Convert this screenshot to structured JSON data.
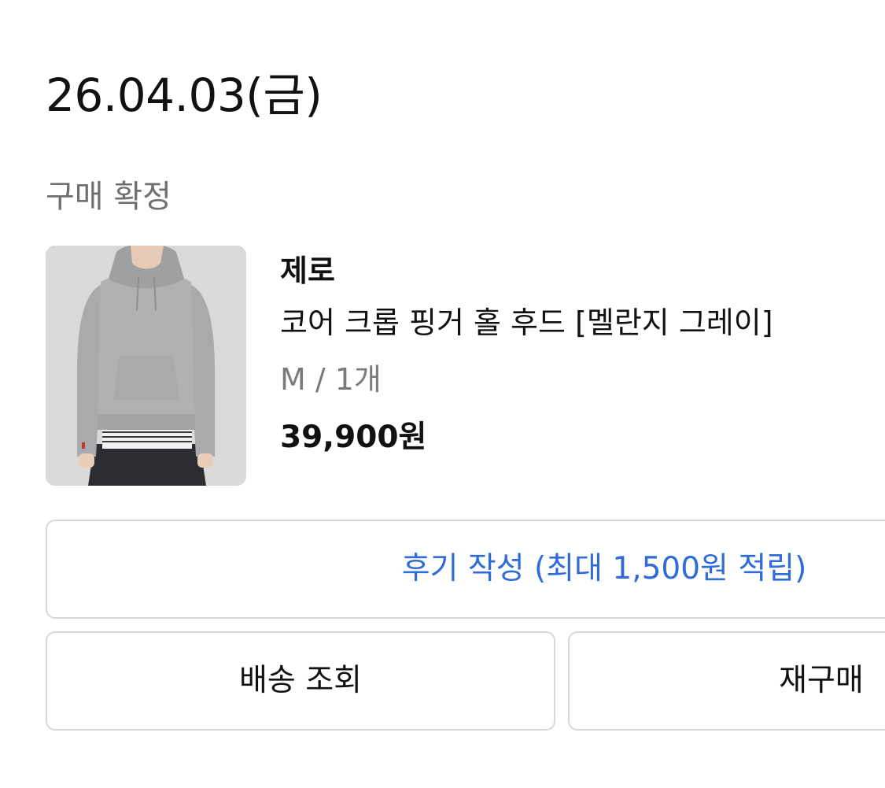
{
  "order": {
    "date": "26.04.03(금)",
    "status": "구매 확정"
  },
  "product": {
    "brand": "제로",
    "name": "코어 크롭 핑거 홀 후드 [멜란지 그레이]",
    "option": "M / 1개",
    "price": "39,900원"
  },
  "actions": {
    "review_label": "후기 작성 (최대 1,500원 적립)",
    "track_label": "배송 조회",
    "rebuy_label": "재구매"
  },
  "colors": {
    "accent": "#2f6bd9",
    "status_text": "#6f6f6f",
    "border": "#d8d8d8"
  }
}
